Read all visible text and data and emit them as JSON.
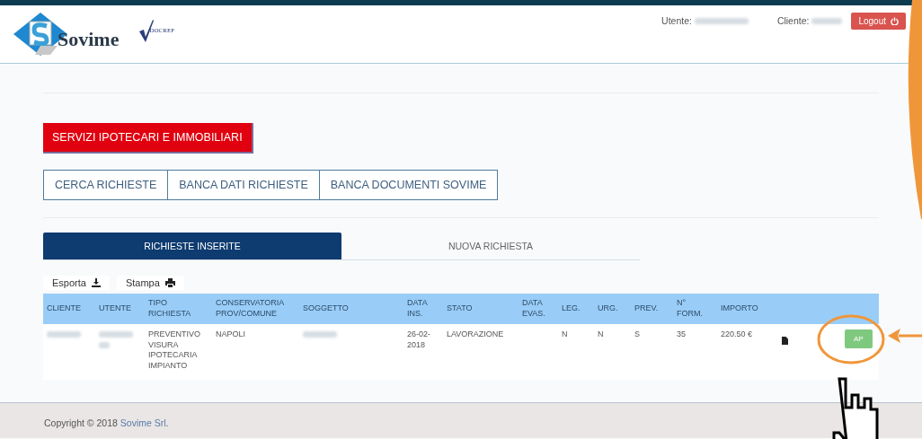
{
  "header": {
    "logo_text": "Sovime",
    "badge_text": "DOCREF",
    "user_label": "Utente:",
    "client_label": "Cliente:",
    "logout": "Logout"
  },
  "section_button": "SERVIZI IPOTECARI E IMMOBILIARI",
  "nav": [
    "CERCA RICHIESTE",
    "BANCA DATI RICHIESTE",
    "BANCA DOCUMENTI SOVIME"
  ],
  "tabs": [
    {
      "label": "RICHIESTE INSERITE",
      "selected": true
    },
    {
      "label": "NUOVA RICHIESTA",
      "selected": false
    }
  ],
  "toolbar": [
    {
      "label": "Esporta",
      "kind": "download"
    },
    {
      "label": "Stampa",
      "kind": "print"
    }
  ],
  "table": {
    "columns": [
      "CLIENTE",
      "UTENTE",
      "TIPO RICHIESTA",
      "CONSERVATORIA PROV/COMUNE",
      "SOGGETTO",
      "DATA INS.",
      "STATO",
      "DATA EVAS.",
      "LEG.",
      "URG.",
      "PREV.",
      "N° FORM.",
      "IMPORTO"
    ],
    "rows": [
      {
        "cells": [
          {
            "kind": "redacted"
          },
          {
            "kind": "redacted"
          },
          {
            "kind": "text",
            "text": "PREVENTIVO VISURA IPOTECARIA IMPIANTO"
          },
          {
            "kind": "text",
            "text": "NAPOLI"
          },
          {
            "kind": "redacted"
          },
          {
            "kind": "text",
            "text": "26-02-2018"
          },
          {
            "kind": "text",
            "text": "LAVORAZIONE"
          },
          {
            "kind": "empty"
          },
          {
            "kind": "text",
            "text": "N"
          },
          {
            "kind": "text",
            "text": "N"
          },
          {
            "kind": "text",
            "text": "S"
          },
          {
            "kind": "text",
            "text": "35"
          },
          {
            "kind": "text",
            "text": "220.50 €"
          }
        ],
        "actions": [
          {
            "kind": "document"
          },
          {
            "kind": "badge",
            "label": "AP"
          }
        ]
      }
    ]
  },
  "footer": {
    "text": "Copyright © 2018 ",
    "link": "Sovime Srl",
    "end": "."
  }
}
